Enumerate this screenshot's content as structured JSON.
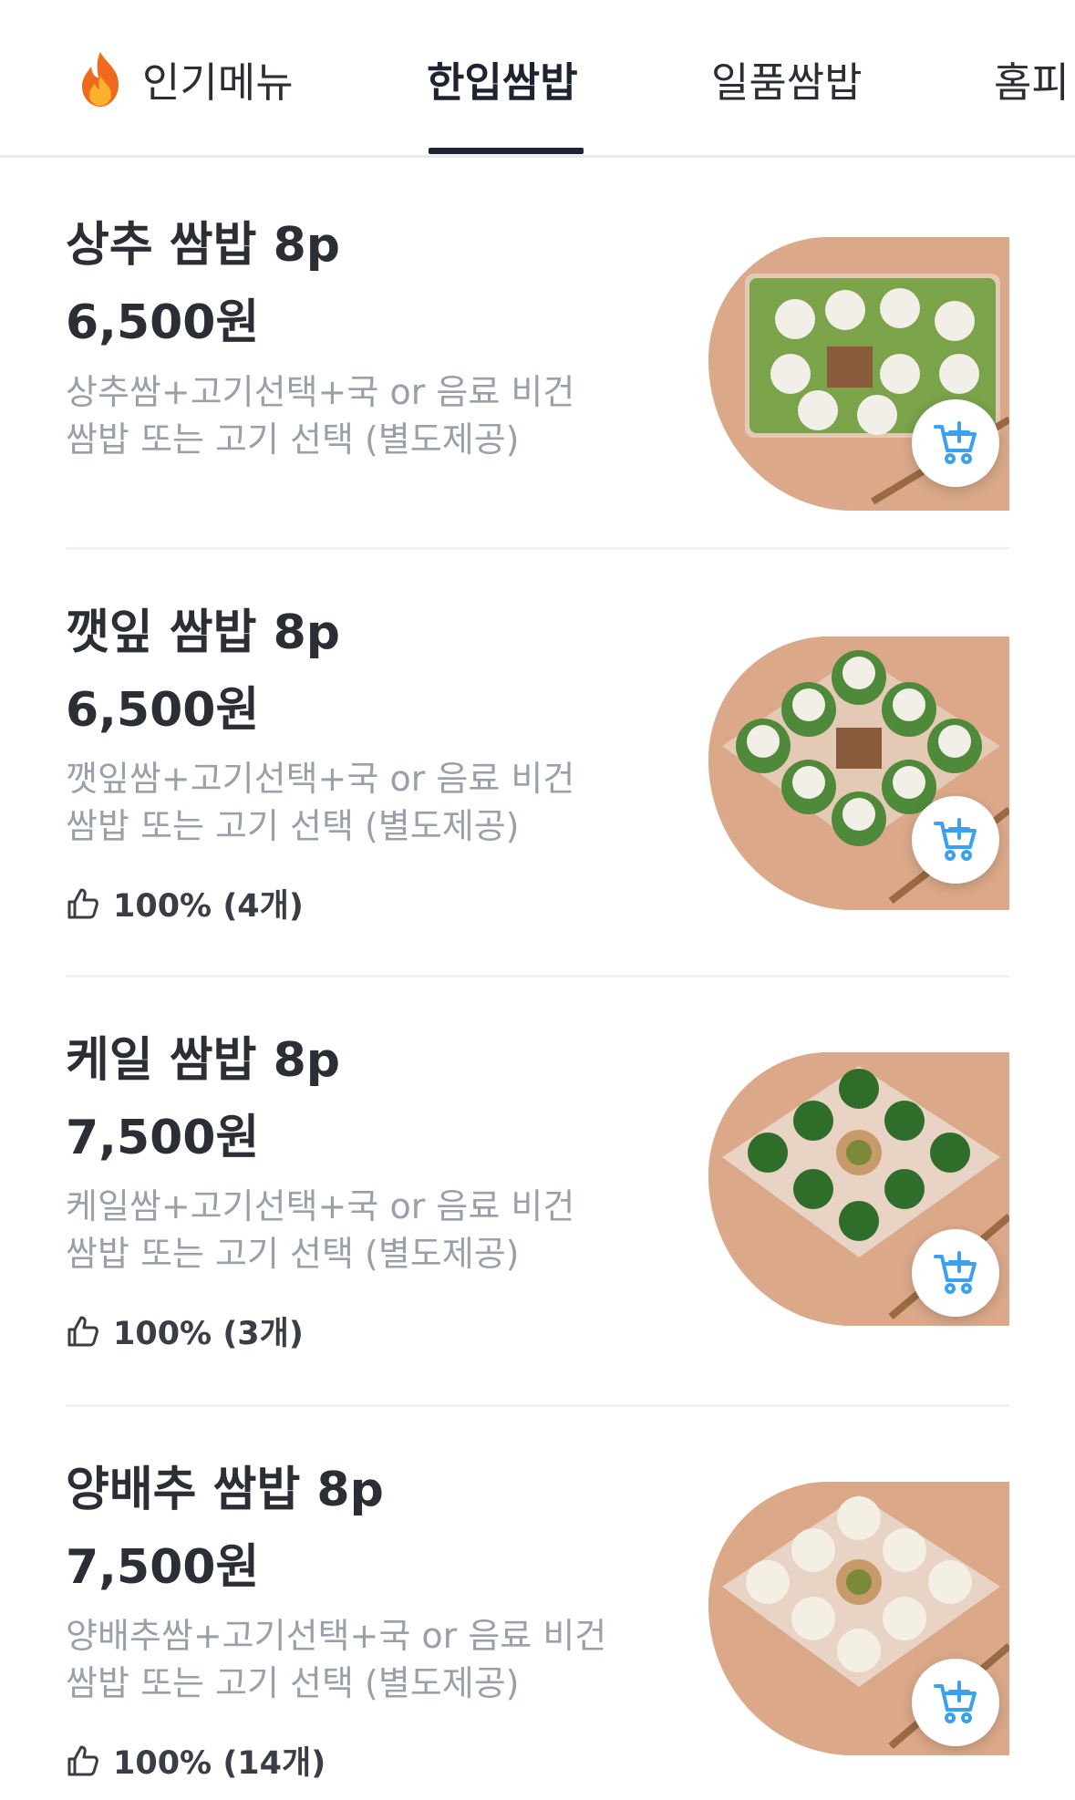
{
  "tabs": [
    {
      "label": "인기메뉴",
      "active": false,
      "icon": "fire-icon"
    },
    {
      "label": "한입쌈밥",
      "active": true
    },
    {
      "label": "일품쌈밥",
      "active": false
    },
    {
      "label": "홈피",
      "active": false
    }
  ],
  "colors": {
    "accent": "#1f2233",
    "cart_icon": "#3aa0f0",
    "text_primary": "#2b2e35",
    "text_secondary": "#9aa0aa"
  },
  "items": [
    {
      "name": "상추 쌈밥 8p",
      "price": "6,500원",
      "desc_line1": "상추쌈+고기선택+국 or 음료 비건",
      "desc_line2": "쌈밥 또는 고기 선택 (별도제공)",
      "rating": null,
      "cart_icon": "add-to-cart-icon"
    },
    {
      "name": "깻잎 쌈밥 8p",
      "price": "6,500원",
      "desc_line1": "깻잎쌈+고기선택+국 or 음료 비건",
      "desc_line2": "쌈밥 또는 고기 선택 (별도제공)",
      "rating": "100% (4개)",
      "cart_icon": "add-to-cart-icon"
    },
    {
      "name": "케일 쌈밥 8p",
      "price": "7,500원",
      "desc_line1": "케일쌈+고기선택+국 or 음료 비건",
      "desc_line2": "쌈밥 또는 고기 선택 (별도제공)",
      "rating": "100% (3개)",
      "cart_icon": "add-to-cart-icon"
    },
    {
      "name": "양배추 쌈밥 8p",
      "price": "7,500원",
      "desc_line1": "양배추쌈+고기선택+국 or 음료 비건",
      "desc_line2": "쌈밥 또는 고기 선택 (별도제공)",
      "rating": "100% (14개)",
      "cart_icon": "add-to-cart-icon"
    }
  ]
}
